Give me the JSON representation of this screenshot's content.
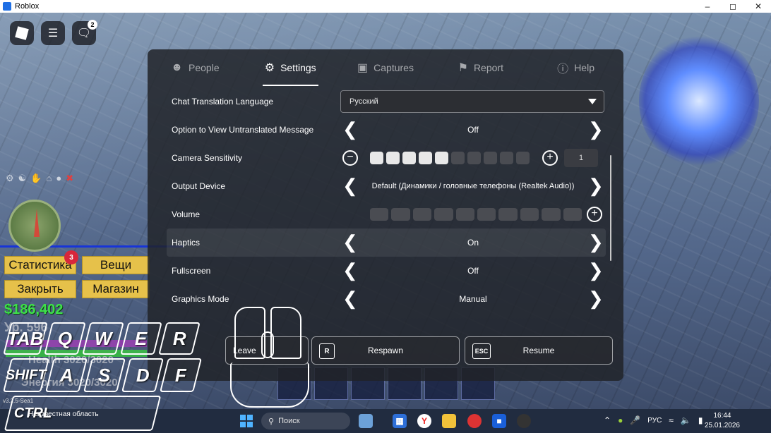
{
  "window": {
    "title": "Roblox"
  },
  "hud": {
    "chat_badge": "2",
    "stats_badge": "3"
  },
  "left_menu": {
    "stats": "Статистика",
    "items": "Вещи",
    "close": "Закрыть",
    "shop": "Магазин"
  },
  "player": {
    "money": "$186,402",
    "health_partial": "Health 3020/3020",
    "energy_partial": "Энергия 3020/3020",
    "level_partial": "Ур. 596"
  },
  "keys": [
    "TAB",
    "Q",
    "W",
    "E",
    "R",
    "SHIFT",
    "A",
    "S",
    "D",
    "F",
    "CTRL"
  ],
  "tabs": [
    {
      "label": "People",
      "icon": "people-icon"
    },
    {
      "label": "Settings",
      "icon": "gear-icon"
    },
    {
      "label": "Captures",
      "icon": "camera-icon"
    },
    {
      "label": "Report",
      "icon": "flag-icon"
    },
    {
      "label": "Help",
      "icon": "help-icon"
    }
  ],
  "settings": {
    "chat_translation": {
      "label": "Chat Translation Language",
      "value": "Русский"
    },
    "untranslated": {
      "label": "Option to View Untranslated Message",
      "value": "Off"
    },
    "camera": {
      "label": "Camera Sensitivity",
      "value": "1",
      "level": 5,
      "steps": 10
    },
    "output_device": {
      "label": "Output Device",
      "value": "Default (Динамики / головные телефоны (Realtek Audio))"
    },
    "volume": {
      "label": "Volume",
      "level": 0,
      "steps": 10
    },
    "haptics": {
      "label": "Haptics",
      "value": "On"
    },
    "fullscreen": {
      "label": "Fullscreen",
      "value": "Off"
    },
    "graphics_mode": {
      "label": "Graphics Mode",
      "value": "Manual"
    }
  },
  "footer": {
    "leave": {
      "label": "Leave"
    },
    "respawn": {
      "key": "R",
      "label": "Respawn"
    },
    "resume": {
      "key": "ESC",
      "label": "Resume"
    }
  },
  "footer_version": "v3.2.5-Sea1",
  "location": "Неизвестная область",
  "taskbar": {
    "search": "Поиск",
    "lang": "РУС",
    "time": "16:44",
    "date": "25.01.2026"
  },
  "colors": {
    "panel": "#202227",
    "money": "#3ee04a",
    "menu_button": "#e6c14a",
    "accent_blue": "#1734d8"
  }
}
